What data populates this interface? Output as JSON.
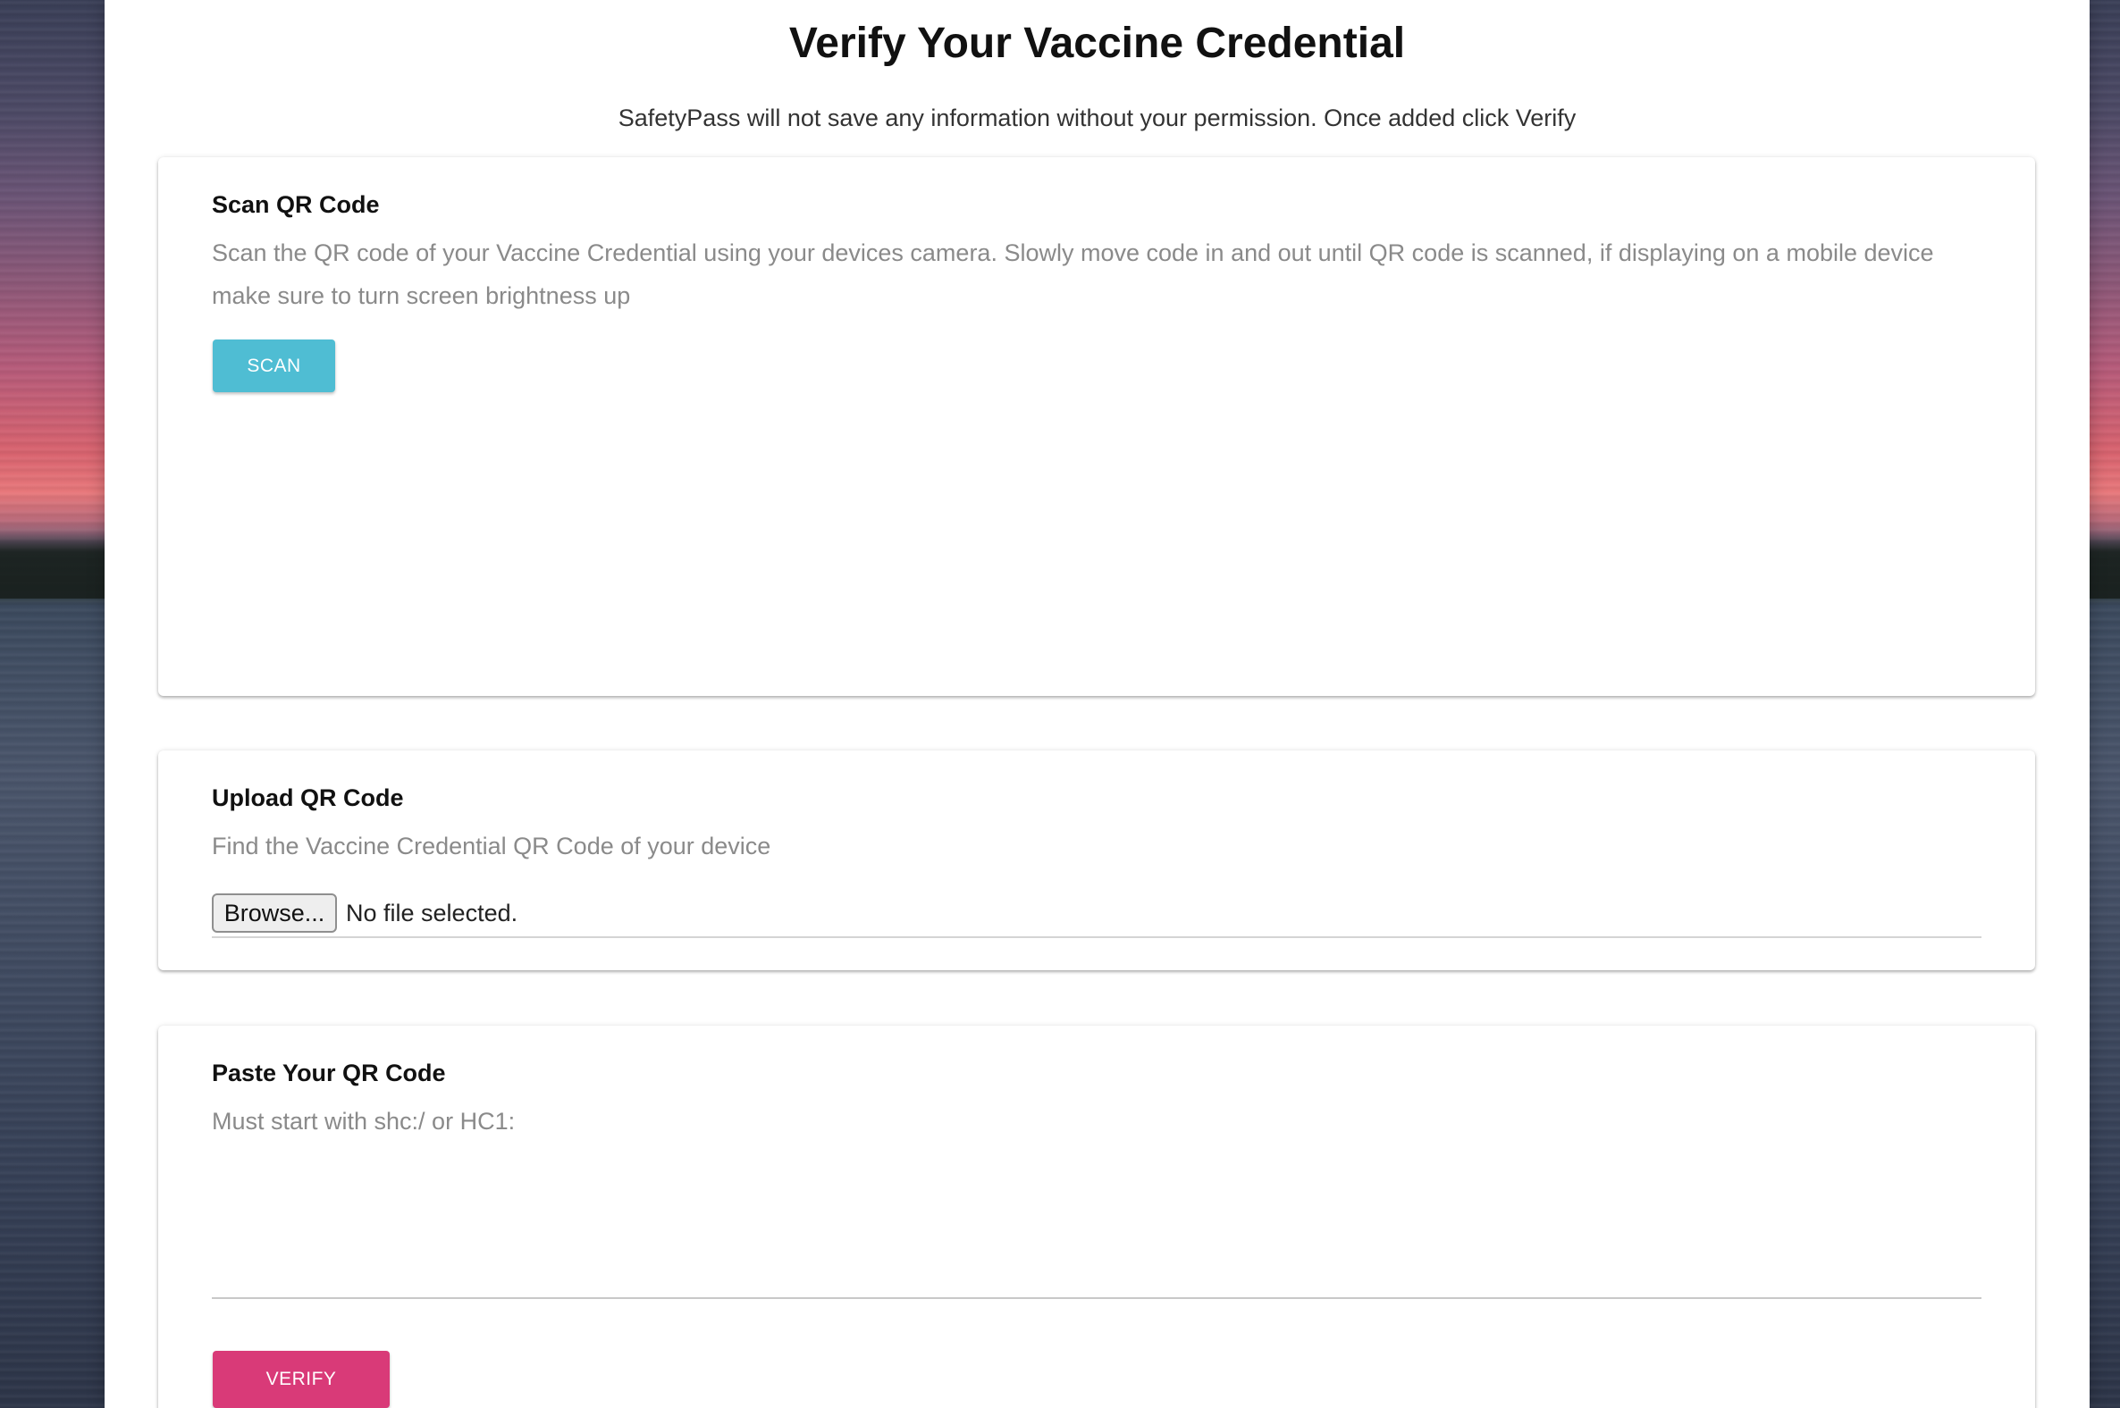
{
  "header": {
    "title": "Verify Your Vaccine Credential",
    "subtitle": "SafetyPass will not save any information without your permission. Once added click Verify"
  },
  "scan_card": {
    "title": "Scan QR Code",
    "description": "Scan the QR code of your Vaccine Credential using your devices camera. Slowly move code in and out until QR code is scanned, if displaying on a mobile device make sure to turn screen brightness up",
    "button_label": "SCAN"
  },
  "upload_card": {
    "title": "Upload QR Code",
    "description": "Find the Vaccine Credential QR Code of your device",
    "browse_label": "Browse...",
    "file_status": "No file selected."
  },
  "paste_card": {
    "title": "Paste Your QR Code",
    "description": "Must start with shc:/ or HC1:",
    "input_value": "",
    "button_label": "VERIFY"
  },
  "colors": {
    "scan_button": "#4fbdd3",
    "verify_button": "#d93a78"
  }
}
